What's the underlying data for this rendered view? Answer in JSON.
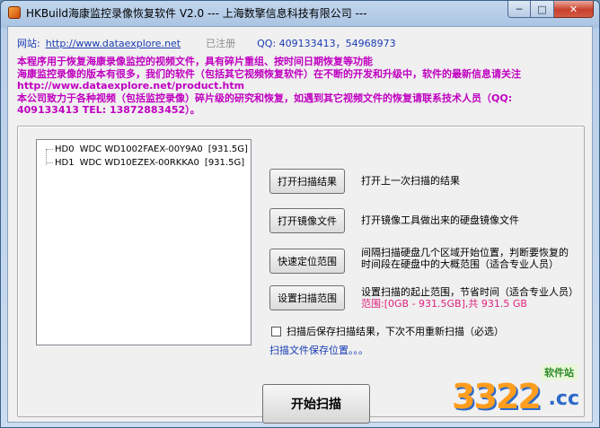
{
  "window": {
    "title": "HKBuild海康监控录像恢复软件 V2.0 --- 上海数擎信息科技有限公司 ---",
    "controls": {
      "minimize": "─",
      "maximize": "□",
      "close": "✕"
    }
  },
  "info": {
    "website_label": "网站:",
    "website_url": "http://www.dataexplore.net",
    "registered": "已注册",
    "qq": "QQ: 409133413，54968973"
  },
  "notice": {
    "lines": [
      "本程序用于恢复海康录像监控的视频文件，具有碎片重组、按时间日期恢复等功能",
      "海康监控录像的版本有很多，我们的软件（包括其它视频恢复软件）在不断的开发和升级中，软件的最新信息请关注",
      "http://www.dataexplore.net/product.htm",
      "本公司致力于各种视频（包括监控录像）碎片级的研究和恢复，如遇到其它视频文件的恢复请联系技术人员（QQ:",
      "409133413 TEL: 13872883452）。"
    ]
  },
  "disks": [
    {
      "id": "HD0",
      "model": "WDC WD1002FAEX-00Y9A0",
      "size": "[931.5G]"
    },
    {
      "id": "HD1",
      "model": "WDC WD10EZEX-00RKKA0",
      "size": "[931.5G]"
    }
  ],
  "actions": {
    "open_scan": {
      "label": "打开扫描结果",
      "desc": "打开上一次扫描的结果"
    },
    "open_image": {
      "label": "打开镜像文件",
      "desc": "打开镜像工具做出来的硬盘镜像文件"
    },
    "quick_locate": {
      "label": "快速定位范围",
      "desc1": "间隔扫描硬盘几个区域开始位置，判断要恢复的",
      "desc2": "时间段在硬盘中的大概范围（适合专业人员）"
    },
    "set_range": {
      "label": "设置扫描范围",
      "desc": "设置扫描的起止范围，节省时间（适合专业人员）",
      "range": "范围:[0GB - 931.5GB],共 931.5 GB"
    }
  },
  "save_option": {
    "label": "扫描后保存扫描结果，下次不用重新扫描（必选）"
  },
  "save_path": "扫描文件保存位置。。。",
  "start_button": "开始扫描",
  "watermark": {
    "tag": "软件站",
    "digits": "3322",
    "cc": ".cc"
  },
  "colors": {
    "notice": "#c000c0",
    "link": "#1a3cb3",
    "range": "#e0217e"
  }
}
